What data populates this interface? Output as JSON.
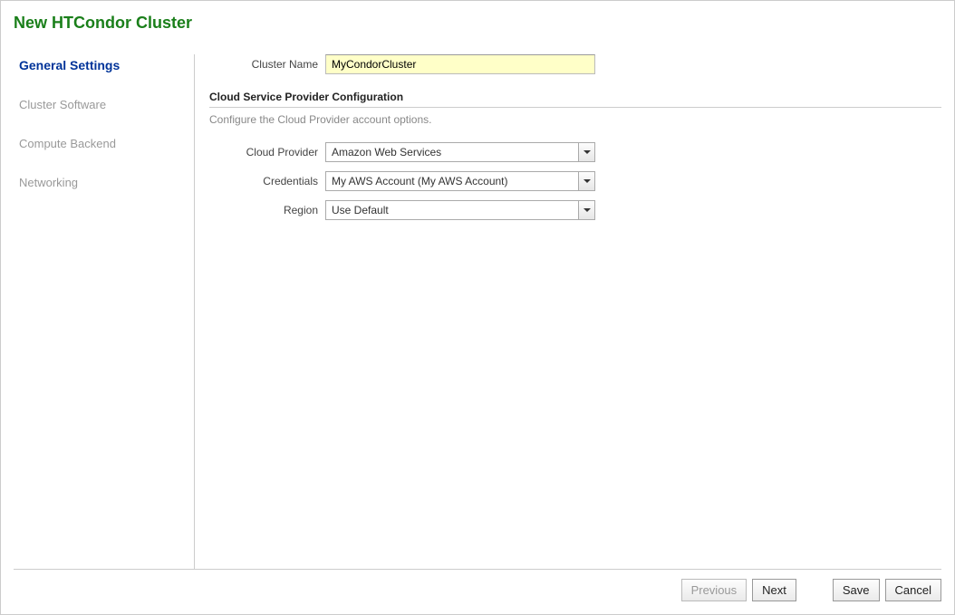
{
  "page": {
    "title": "New HTCondor Cluster"
  },
  "sidebar": {
    "items": [
      {
        "label": "General Settings",
        "active": true
      },
      {
        "label": "Cluster Software",
        "active": false
      },
      {
        "label": "Compute Backend",
        "active": false
      },
      {
        "label": "Networking",
        "active": false
      }
    ]
  },
  "form": {
    "cluster_name": {
      "label": "Cluster Name",
      "value": "MyCondorCluster"
    },
    "section": {
      "heading": "Cloud Service Provider Configuration",
      "description": "Configure the Cloud Provider account options."
    },
    "cloud_provider": {
      "label": "Cloud Provider",
      "value": "Amazon Web Services"
    },
    "credentials": {
      "label": "Credentials",
      "value": "My AWS Account (My AWS Account)"
    },
    "region": {
      "label": "Region",
      "value": "Use Default"
    }
  },
  "footer": {
    "previous": "Previous",
    "next": "Next",
    "save": "Save",
    "cancel": "Cancel"
  }
}
